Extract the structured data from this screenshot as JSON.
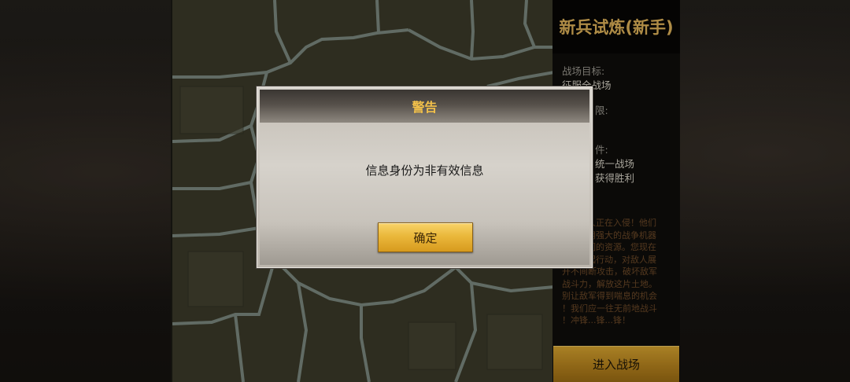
{
  "mission": {
    "title": "新兵试炼(新手)",
    "objective_label": "战场目标:",
    "objective_value": "征服全战场",
    "time_label": "限:",
    "condition_label": "件:",
    "condition_line1": "统一战场",
    "condition_line2": "获得胜利",
    "story_lines": [
      "人正在入侵！他们",
      "用强大的战争机器",
      "们的资源。您现在",
      "起行动，对敌人展",
      "开不间断攻击，破坏敌军",
      "战斗力，解放这片土地。",
      "别让敌军得到喘息的机会",
      "！我们应一往无前地战斗",
      "！冲锋...锋...锋！"
    ],
    "enter_button": "进入战场"
  },
  "dialog": {
    "title": "警告",
    "message": "信息身份为非有效信息",
    "confirm_button": "确定"
  },
  "colors": {
    "title_gold": "#e0b45a",
    "button_gold": "#eab83b",
    "map_ground": "#3b3a2a"
  }
}
